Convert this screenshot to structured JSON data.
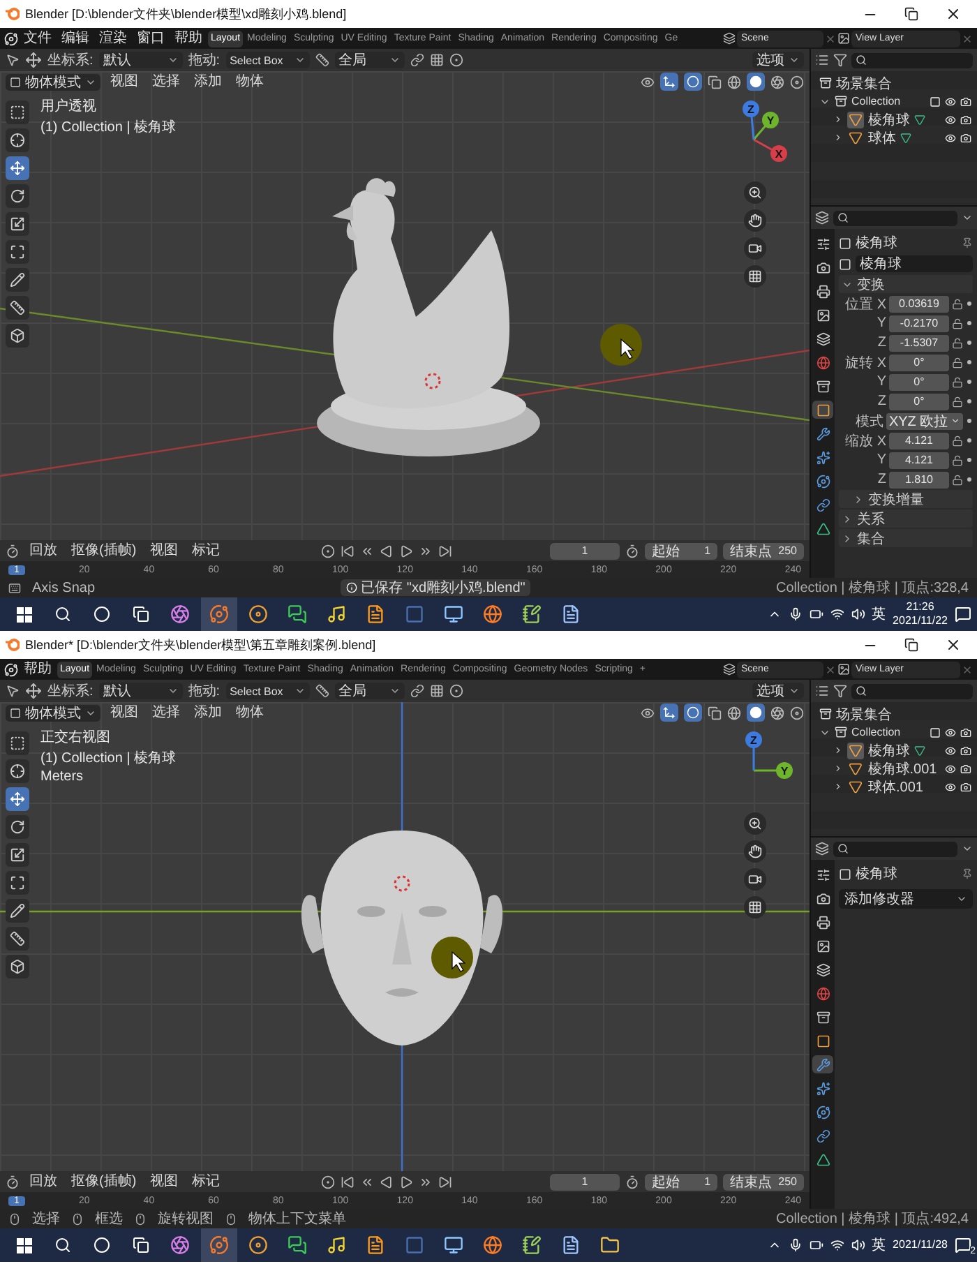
{
  "windows": [
    {
      "title": "Blender [D:\\blender文件夹\\blender模型\\xd雕刻小鸡.blend]",
      "menus": [
        "文件",
        "编辑",
        "渲染",
        "窗口",
        "帮助"
      ],
      "workspace_tabs": [
        {
          "label": "Layout",
          "selected": true
        },
        {
          "label": "Modeling",
          "selected": false
        },
        {
          "label": "Sculpting",
          "selected": false
        },
        {
          "label": "UV Editing",
          "selected": false
        },
        {
          "label": "Texture Paint",
          "selected": false
        },
        {
          "label": "Shading",
          "selected": false
        },
        {
          "label": "Animation",
          "selected": false
        },
        {
          "label": "Rendering",
          "selected": false
        },
        {
          "label": "Compositing",
          "selected": false
        },
        {
          "label": "Ge",
          "selected": false
        }
      ],
      "scene": "Scene",
      "view_layer": "View Layer",
      "tool_header": {
        "orientation_label": "坐标系:",
        "orientation": "默认",
        "drag_label": "拖动:",
        "drag": "Select Box",
        "pivot": "全局",
        "options": "选项"
      },
      "viewport": {
        "mode": "物体模式",
        "menus": [
          "视图",
          "选择",
          "添加",
          "物体"
        ],
        "kind": "perspective",
        "model": {
          "kind": "hen"
        },
        "overlay_lines": [
          "用户透视",
          "(1) Collection | 棱角球"
        ],
        "gizmo": {
          "x": "X",
          "y": "Y",
          "z": "Z"
        },
        "tools": [
          {
            "kind": "select",
            "selected": false
          },
          {
            "kind": "cursor",
            "selected": false
          },
          {
            "kind": "move",
            "selected": true
          },
          {
            "kind": "rotate",
            "selected": false
          },
          {
            "kind": "scale",
            "selected": false
          },
          {
            "kind": "transform",
            "selected": false
          },
          {
            "kind": "annotate",
            "selected": false
          },
          {
            "kind": "measure",
            "selected": false
          },
          {
            "kind": "add_cube",
            "selected": false
          }
        ]
      },
      "outliner": {
        "root": "场景集合",
        "collection": "Collection",
        "expanded": true,
        "items": [
          {
            "name": "棱角球",
            "selected": true,
            "mesh_data": true
          },
          {
            "name": "球体",
            "selected": false,
            "mesh_data": true
          }
        ]
      },
      "properties": {
        "kind": "object",
        "object_name": "棱角球",
        "data_name": "棱角球",
        "tabs": [
          {
            "kind": "tool",
            "selected": false
          },
          {
            "kind": "render",
            "selected": false
          },
          {
            "kind": "output",
            "selected": false
          },
          {
            "kind": "view_layer",
            "selected": false
          },
          {
            "kind": "scene",
            "selected": false
          },
          {
            "kind": "world",
            "selected": false
          },
          {
            "kind": "collection",
            "selected": false
          },
          {
            "kind": "object",
            "selected": true
          },
          {
            "kind": "modifiers",
            "selected": false
          },
          {
            "kind": "particles",
            "selected": false
          },
          {
            "kind": "physics",
            "selected": false
          },
          {
            "kind": "constraints",
            "selected": false
          },
          {
            "kind": "data",
            "selected": false
          }
        ],
        "sections": [
          {
            "title": "变换",
            "expanded": true,
            "nested": false,
            "rows": [
              {
                "label": "位置 X",
                "value": "0.03619",
                "kind": "number"
              },
              {
                "label": "Y",
                "value": "-0.2170",
                "kind": "number"
              },
              {
                "label": "Z",
                "value": "-1.5307",
                "kind": "number"
              },
              {
                "label": "旋转 X",
                "value": "0°",
                "kind": "number"
              },
              {
                "label": "Y",
                "value": "0°",
                "kind": "number"
              },
              {
                "label": "Z",
                "value": "0°",
                "kind": "number"
              },
              {
                "label": "模式",
                "value": "XYZ 欧拉",
                "kind": "dropdown"
              },
              {
                "label": "缩放 X",
                "value": "4.121",
                "kind": "number"
              },
              {
                "label": "Y",
                "value": "4.121",
                "kind": "number"
              },
              {
                "label": "Z",
                "value": "1.810",
                "kind": "number"
              }
            ]
          },
          {
            "title": "变换增量",
            "expanded": false,
            "nested": true
          },
          {
            "title": "关系",
            "expanded": false,
            "nested": false
          },
          {
            "title": "集合",
            "expanded": false,
            "nested": false
          }
        ]
      },
      "timeline": {
        "playback": "回放",
        "keying": "抠像(插帧)",
        "view": "视图",
        "marker": "标记",
        "current_frame": "1",
        "start_label": "起始",
        "start": "1",
        "end_label": "结束点",
        "end": "250"
      },
      "ruler": {
        "current": "1",
        "ticks": [
          "20",
          "40",
          "60",
          "80",
          "100",
          "120",
          "140",
          "160",
          "180",
          "200",
          "220",
          "240"
        ]
      },
      "status": {
        "hints": [
          {
            "kind": "key",
            "text": "Axis Snap"
          }
        ],
        "notice": "已保存 \"xd雕刻小鸡.blend\"",
        "stats": "Collection | 棱角球 | 顶点:328,4"
      },
      "taskbar": {
        "apps": [
          {
            "kind": "swirl",
            "selected": false
          },
          {
            "kind": "blender",
            "selected": true
          },
          {
            "kind": "rings",
            "selected": false
          },
          {
            "kind": "chat",
            "selected": false
          },
          {
            "kind": "music",
            "selected": false
          },
          {
            "kind": "editor",
            "selected": false
          },
          {
            "kind": "dark",
            "selected": false
          },
          {
            "kind": "monitor",
            "selected": false
          },
          {
            "kind": "browser",
            "selected": false
          },
          {
            "kind": "notepad",
            "selected": false
          },
          {
            "kind": "document",
            "selected": false
          }
        ],
        "ime": "英",
        "time": "21:26",
        "date": "2021/11/22"
      }
    },
    {
      "title": "Blender* [D:\\blender文件夹\\blender模型\\第五章雕刻案例.blend]",
      "menus": [
        "帮助"
      ],
      "workspace_tabs": [
        {
          "label": "Layout",
          "selected": true
        },
        {
          "label": "Modeling",
          "selected": false
        },
        {
          "label": "Sculpting",
          "selected": false
        },
        {
          "label": "UV Editing",
          "selected": false
        },
        {
          "label": "Texture Paint",
          "selected": false
        },
        {
          "label": "Shading",
          "selected": false
        },
        {
          "label": "Animation",
          "selected": false
        },
        {
          "label": "Rendering",
          "selected": false
        },
        {
          "label": "Compositing",
          "selected": false
        },
        {
          "label": "Geometry Nodes",
          "selected": false
        },
        {
          "label": "Scripting",
          "selected": false
        }
      ],
      "add_tab": "+",
      "scene": "Scene",
      "view_layer": "View Layer",
      "tool_header": {
        "orientation_label": "坐标系:",
        "orientation": "默认",
        "drag_label": "拖动:",
        "drag": "Select Box",
        "pivot": "全局",
        "options": "选项"
      },
      "viewport": {
        "mode": "物体模式",
        "menus": [
          "视图",
          "选择",
          "添加",
          "物体"
        ],
        "kind": "right",
        "model": {
          "kind": "head"
        },
        "overlay_lines": [
          "正交右视图",
          "(1) Collection | 棱角球",
          "Meters"
        ],
        "gizmo": {
          "y": "Y",
          "z": "Z"
        },
        "tools": [
          {
            "kind": "select",
            "selected": false
          },
          {
            "kind": "cursor",
            "selected": false
          },
          {
            "kind": "move",
            "selected": true
          },
          {
            "kind": "rotate",
            "selected": false
          },
          {
            "kind": "scale",
            "selected": false
          },
          {
            "kind": "transform",
            "selected": false
          },
          {
            "kind": "annotate",
            "selected": false
          },
          {
            "kind": "measure",
            "selected": false
          },
          {
            "kind": "add_cube",
            "selected": false
          }
        ]
      },
      "outliner": {
        "root": "场景集合",
        "collection": "Collection",
        "expanded": true,
        "items": [
          {
            "name": "棱角球",
            "selected": true,
            "mesh_data": true
          },
          {
            "name": "棱角球.001",
            "selected": false,
            "mesh_data": false
          },
          {
            "name": "球体.001",
            "selected": false,
            "mesh_data": false
          }
        ]
      },
      "properties": {
        "kind": "modifiers",
        "object_name": "棱角球",
        "add_modifier": "添加修改器",
        "tabs": [
          {
            "kind": "tool",
            "selected": false
          },
          {
            "kind": "render",
            "selected": false
          },
          {
            "kind": "output",
            "selected": false
          },
          {
            "kind": "view_layer",
            "selected": false
          },
          {
            "kind": "scene",
            "selected": false
          },
          {
            "kind": "world",
            "selected": false
          },
          {
            "kind": "collection",
            "selected": false
          },
          {
            "kind": "object",
            "selected": false
          },
          {
            "kind": "modifiers",
            "selected": true
          },
          {
            "kind": "particles",
            "selected": false
          },
          {
            "kind": "physics",
            "selected": false
          },
          {
            "kind": "constraints",
            "selected": false
          },
          {
            "kind": "data",
            "selected": false
          }
        ]
      },
      "timeline": {
        "playback": "回放",
        "keying": "抠像(插帧)",
        "view": "视图",
        "marker": "标记",
        "current_frame": "1",
        "start_label": "起始",
        "start": "1",
        "end_label": "结束点",
        "end": "250"
      },
      "ruler": {
        "current": "1",
        "ticks": [
          "20",
          "40",
          "60",
          "80",
          "100",
          "120",
          "140",
          "160",
          "180",
          "200",
          "220",
          "240"
        ]
      },
      "status": {
        "hints": [
          {
            "kind": "mouse",
            "text": "选择"
          },
          {
            "kind": "mouse",
            "text": "框选"
          },
          {
            "kind": "mouse",
            "text": "旋转视图"
          },
          {
            "kind": "mouse",
            "text": "物体上下文菜单"
          }
        ],
        "stats": "Collection | 棱角球 | 顶点:492,4"
      },
      "taskbar": {
        "apps": [
          {
            "kind": "swirl",
            "selected": false
          },
          {
            "kind": "blender",
            "selected": true
          },
          {
            "kind": "rings",
            "selected": false
          },
          {
            "kind": "chat",
            "selected": false
          },
          {
            "kind": "music",
            "selected": false
          },
          {
            "kind": "editor",
            "selected": false
          },
          {
            "kind": "dark",
            "selected": false
          },
          {
            "kind": "monitor",
            "selected": false
          },
          {
            "kind": "browser",
            "selected": false
          },
          {
            "kind": "notepad",
            "selected": false
          },
          {
            "kind": "document",
            "selected": false
          },
          {
            "kind": "folder",
            "selected": false
          }
        ],
        "ime": "英",
        "date": "2021/11/28",
        "notification_count": "2"
      }
    }
  ]
}
